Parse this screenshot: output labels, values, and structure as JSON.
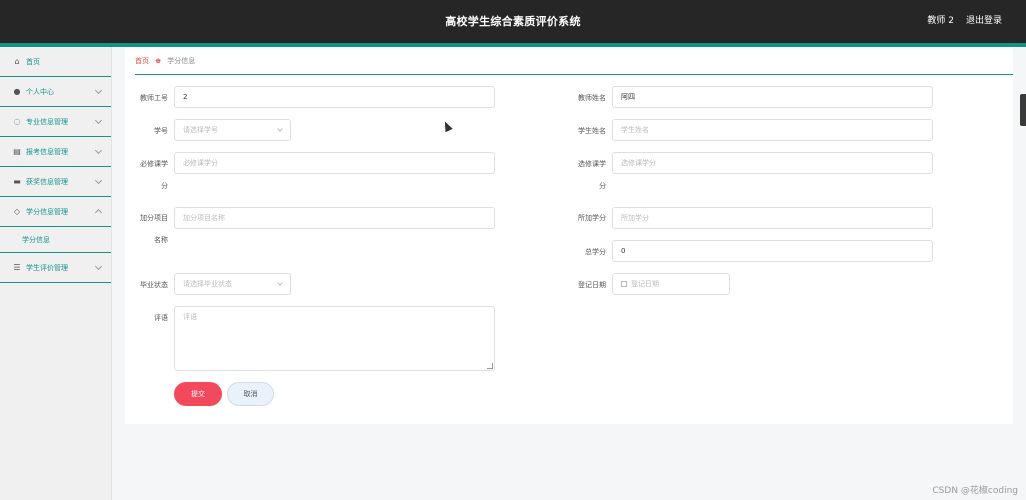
{
  "header": {
    "title": "高校学生综合素质评价系统",
    "user": "教师 2",
    "logout": "退出登录"
  },
  "sidebar": {
    "items": [
      {
        "label": "首页",
        "icon": "home-icon",
        "glyph": "⌂"
      },
      {
        "label": "个人中心",
        "icon": "user-icon",
        "glyph": "●"
      },
      {
        "label": "专业信息管理",
        "icon": "power-icon",
        "glyph": "◌"
      },
      {
        "label": "报考信息管理",
        "icon": "clipboard-icon",
        "glyph": "▤"
      },
      {
        "label": "获奖信息管理",
        "icon": "award-icon",
        "glyph": "▬"
      },
      {
        "label": "学分信息管理",
        "icon": "bell-icon",
        "glyph": "◇"
      },
      {
        "label": "学生评价管理",
        "icon": "sliders-icon",
        "glyph": "☰"
      }
    ],
    "sub": "学分信息"
  },
  "breadcrumb": {
    "home": "首页",
    "sep": "♚",
    "current": "学分信息"
  },
  "form": {
    "teacher_id_label": "教师工号",
    "teacher_id_value": "2",
    "teacher_name_label": "教师姓名",
    "teacher_name_value": "阿四",
    "student_no_label": "学号",
    "student_no_ph": "请选择学号",
    "student_name_label": "学生姓名",
    "student_name_ph": "学生姓名",
    "required_credit_label_a": "必修课学",
    "required_credit_label_b": "分",
    "required_credit_ph": "必修课学分",
    "elective_credit_label_a": "选修课学",
    "elective_credit_label_b": "分",
    "elective_credit_ph": "选修课学分",
    "bonus_item_label_a": "加分项目",
    "bonus_item_label_b": "名称",
    "bonus_item_ph": "加分项目名称",
    "bonus_credit_label": "所加学分",
    "bonus_credit_ph": "所加学分",
    "total_credit_label": "总学分",
    "total_credit_value": "0",
    "grad_status_label": "毕业状态",
    "grad_status_ph": "请选择毕业状态",
    "reg_date_label": "登记日期",
    "reg_date_ph": "登记日期",
    "comment_label": "评语",
    "comment_ph": "评语",
    "submit": "提交",
    "cancel": "取消"
  },
  "footer": {
    "watermark": "CSDN @花椒coding"
  }
}
